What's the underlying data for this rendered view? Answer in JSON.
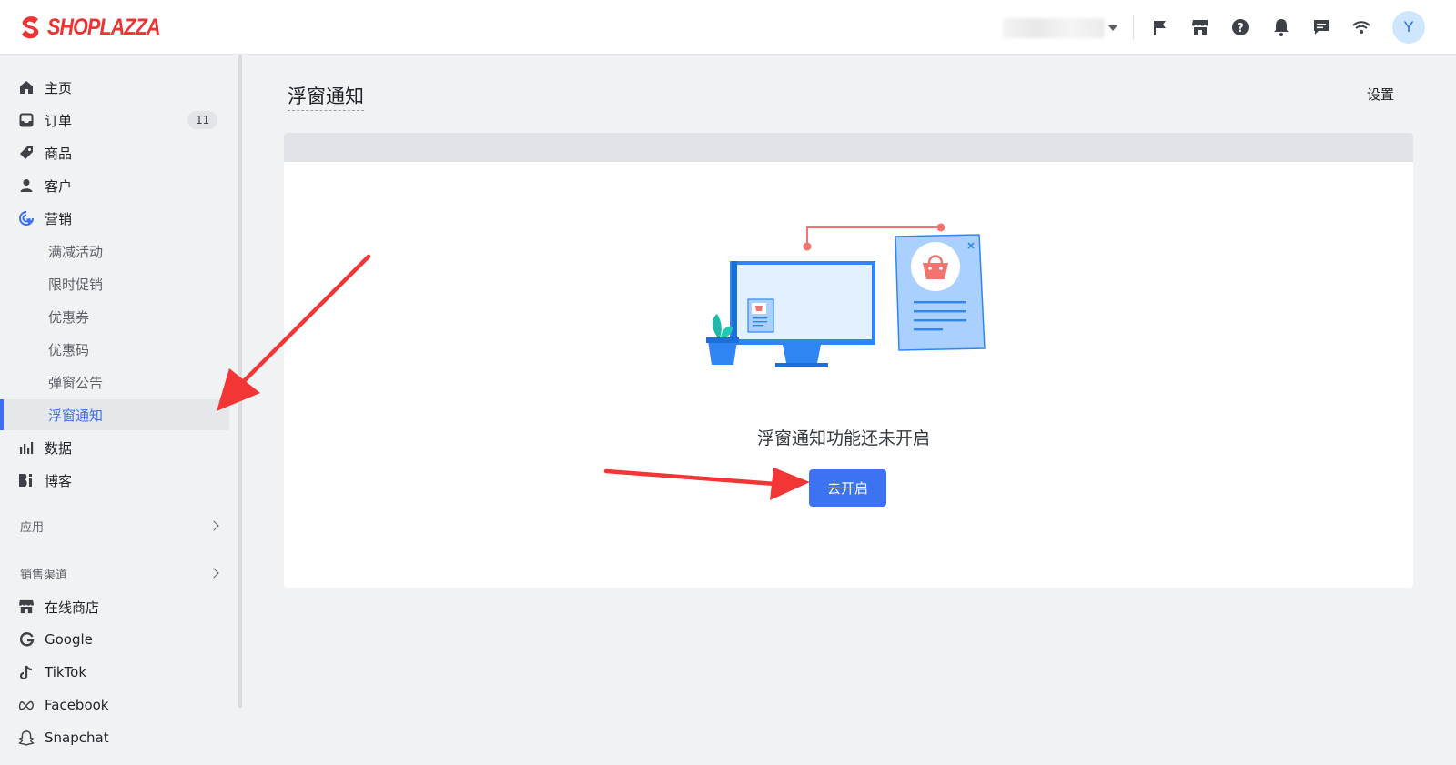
{
  "app": {
    "brand": "SHOPLAZZA",
    "avatar_initial": "Y",
    "accent_color": "#3b73f2",
    "brand_color": "#ee3333"
  },
  "header": {
    "icons": [
      "flag-icon",
      "store-icon",
      "help-icon",
      "bell-icon",
      "chat-icon",
      "wifi-icon"
    ]
  },
  "sidebar": {
    "items": [
      {
        "label": "主页",
        "icon": "home-icon"
      },
      {
        "label": "订单",
        "icon": "inbox-icon",
        "badge": "11"
      },
      {
        "label": "商品",
        "icon": "tag-icon"
      },
      {
        "label": "客户",
        "icon": "person-icon"
      },
      {
        "label": "营销",
        "icon": "marketing-icon"
      }
    ],
    "marketing_sub": [
      {
        "label": "满减活动"
      },
      {
        "label": "限时促销"
      },
      {
        "label": "优惠券"
      },
      {
        "label": "优惠码"
      },
      {
        "label": "弹窗公告"
      },
      {
        "label": "浮窗通知",
        "active": true
      }
    ],
    "items2": [
      {
        "label": "数据",
        "icon": "chart-icon"
      },
      {
        "label": "博客",
        "icon": "blog-icon"
      }
    ],
    "apps_label": "应用",
    "channels_label": "销售渠道",
    "channels": [
      {
        "label": "在线商店",
        "icon": "store-icon"
      },
      {
        "label": "Google",
        "icon": "google-icon"
      },
      {
        "label": "TikTok",
        "icon": "tiktok-icon"
      },
      {
        "label": "Facebook",
        "icon": "meta-icon"
      },
      {
        "label": "Snapchat",
        "icon": "snapchat-icon"
      }
    ]
  },
  "main": {
    "title": "浮窗通知",
    "settings_label": "设置",
    "empty_message": "浮窗通知功能还未开启",
    "enable_button": "去开启"
  }
}
